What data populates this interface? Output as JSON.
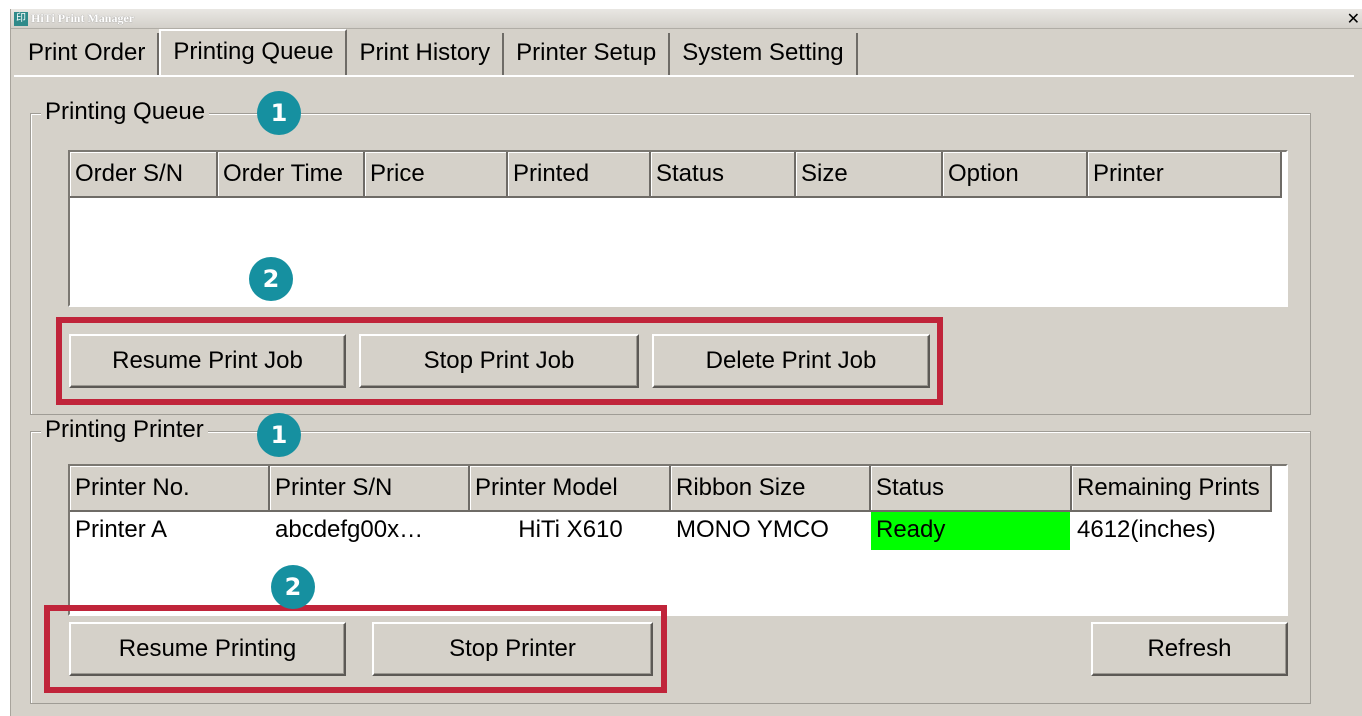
{
  "window": {
    "title": "HiTi Print Manager",
    "app_icon_glyph": "印",
    "close_glyph": "✕"
  },
  "tabs": [
    {
      "label": "Print Order",
      "active": false
    },
    {
      "label": "Printing Queue",
      "active": true
    },
    {
      "label": "Print History",
      "active": false
    },
    {
      "label": "Printer Setup",
      "active": false
    },
    {
      "label": "System Setting",
      "active": false
    }
  ],
  "queue": {
    "legend": "Printing Queue",
    "columns": [
      "Order S/N",
      "Order Time",
      "Price",
      "Printed",
      "Status",
      "Size",
      "Option",
      "Printer"
    ],
    "rows": [],
    "buttons": {
      "resume": "Resume Print Job",
      "stop": "Stop Print Job",
      "delete": "Delete Print Job"
    }
  },
  "printers": {
    "legend": "Printing Printer",
    "columns": [
      "Printer No.",
      "Printer S/N",
      "Printer Model",
      "Ribbon Size",
      "Status",
      "Remaining Prints"
    ],
    "rows": [
      {
        "no": "Printer A",
        "sn": "abcdefg00x…",
        "model": "HiTi X610",
        "ribbon": "MONO YMCO",
        "status": "Ready",
        "remaining": "4612(inches)"
      }
    ],
    "buttons": {
      "resume": "Resume Printing",
      "stop": "Stop Printer",
      "refresh": "Refresh"
    }
  },
  "annotations": {
    "badge_1": "1",
    "badge_2": "2",
    "highlight_color": "#c0243a",
    "badge_color": "#1690a0"
  },
  "colors": {
    "window_bg": "#d5d1c9",
    "status_ready": "#00ff00"
  }
}
